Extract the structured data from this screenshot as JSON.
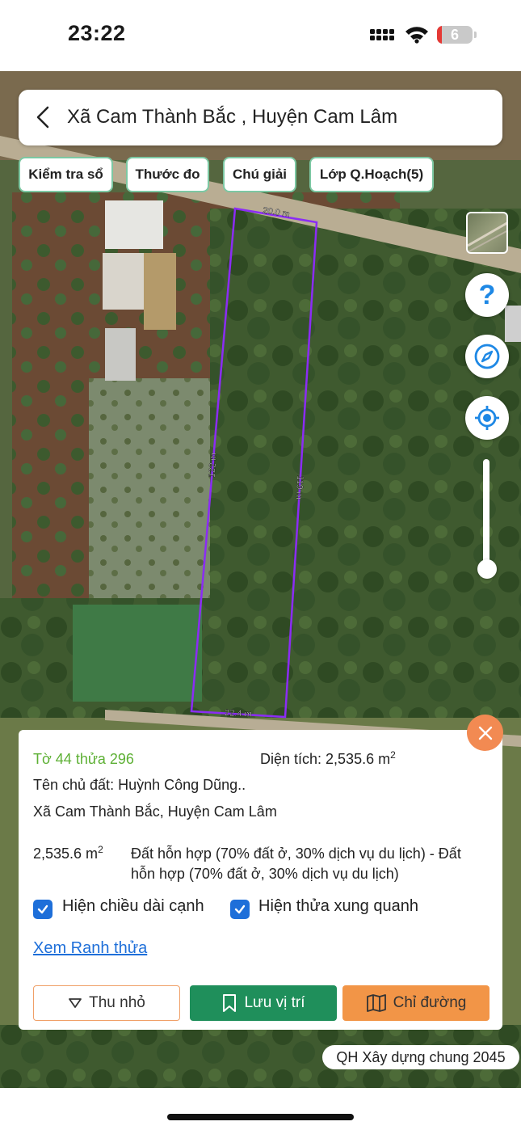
{
  "status_bar": {
    "time": "23:22",
    "battery": "6",
    "icons": [
      "cellular-signal-icon",
      "wifi-icon",
      "battery-icon"
    ]
  },
  "header": {
    "back_icon": "chevron-left-icon",
    "title": "Xã Cam Thành Bắc , Huyện Cam Lâm"
  },
  "toolbar": {
    "chips": [
      "Kiểm tra sổ",
      "Thước đo",
      "Chú giải",
      "Lớp Q.Hoạch(5)"
    ]
  },
  "map": {
    "edge_labels": {
      "top": "20.0 m",
      "left": "122 m",
      "right": "119 m",
      "bottom": "22.4 m"
    },
    "controls": [
      "layer-thumbnail",
      "help-icon",
      "compass-icon",
      "my-location-icon",
      "zoom-slider"
    ],
    "plan_label": "QH Xây dựng chung 2045"
  },
  "parcel": {
    "title": "Tờ 44 thửa 296",
    "area_label": "Diện tích: 2,535.6 m",
    "area_unit_sup": "2",
    "owner": "Tên chủ đất: Huỳnh Công Dũng..",
    "location": "Xã Cam Thành Bắc, Huyện Cam Lâm",
    "size_value": "2,535.6 m",
    "size_sup": "2",
    "land_use": "Đất hỗn hợp (70% đất ở, 30% dịch vụ du lịch) - Đất hỗn hợp (70% đất ở, 30% dịch vụ du lịch)",
    "checkboxes": [
      {
        "label": "Hiện chiều dài cạnh",
        "checked": true
      },
      {
        "label": "Hiện thửa xung quanh",
        "checked": true
      }
    ],
    "boundary_link": "Xem Ranh thửa"
  },
  "actions": {
    "minimize": "Thu nhỏ",
    "save": "Lưu vị trí",
    "directions": "Chỉ đường"
  },
  "colors": {
    "parcel_outline": "#8b2cf5",
    "green_text": "#5db034",
    "save_button": "#1f8f5b",
    "directions_button": "#f29547",
    "close_button": "#f28a52",
    "link": "#1e6fd9"
  }
}
